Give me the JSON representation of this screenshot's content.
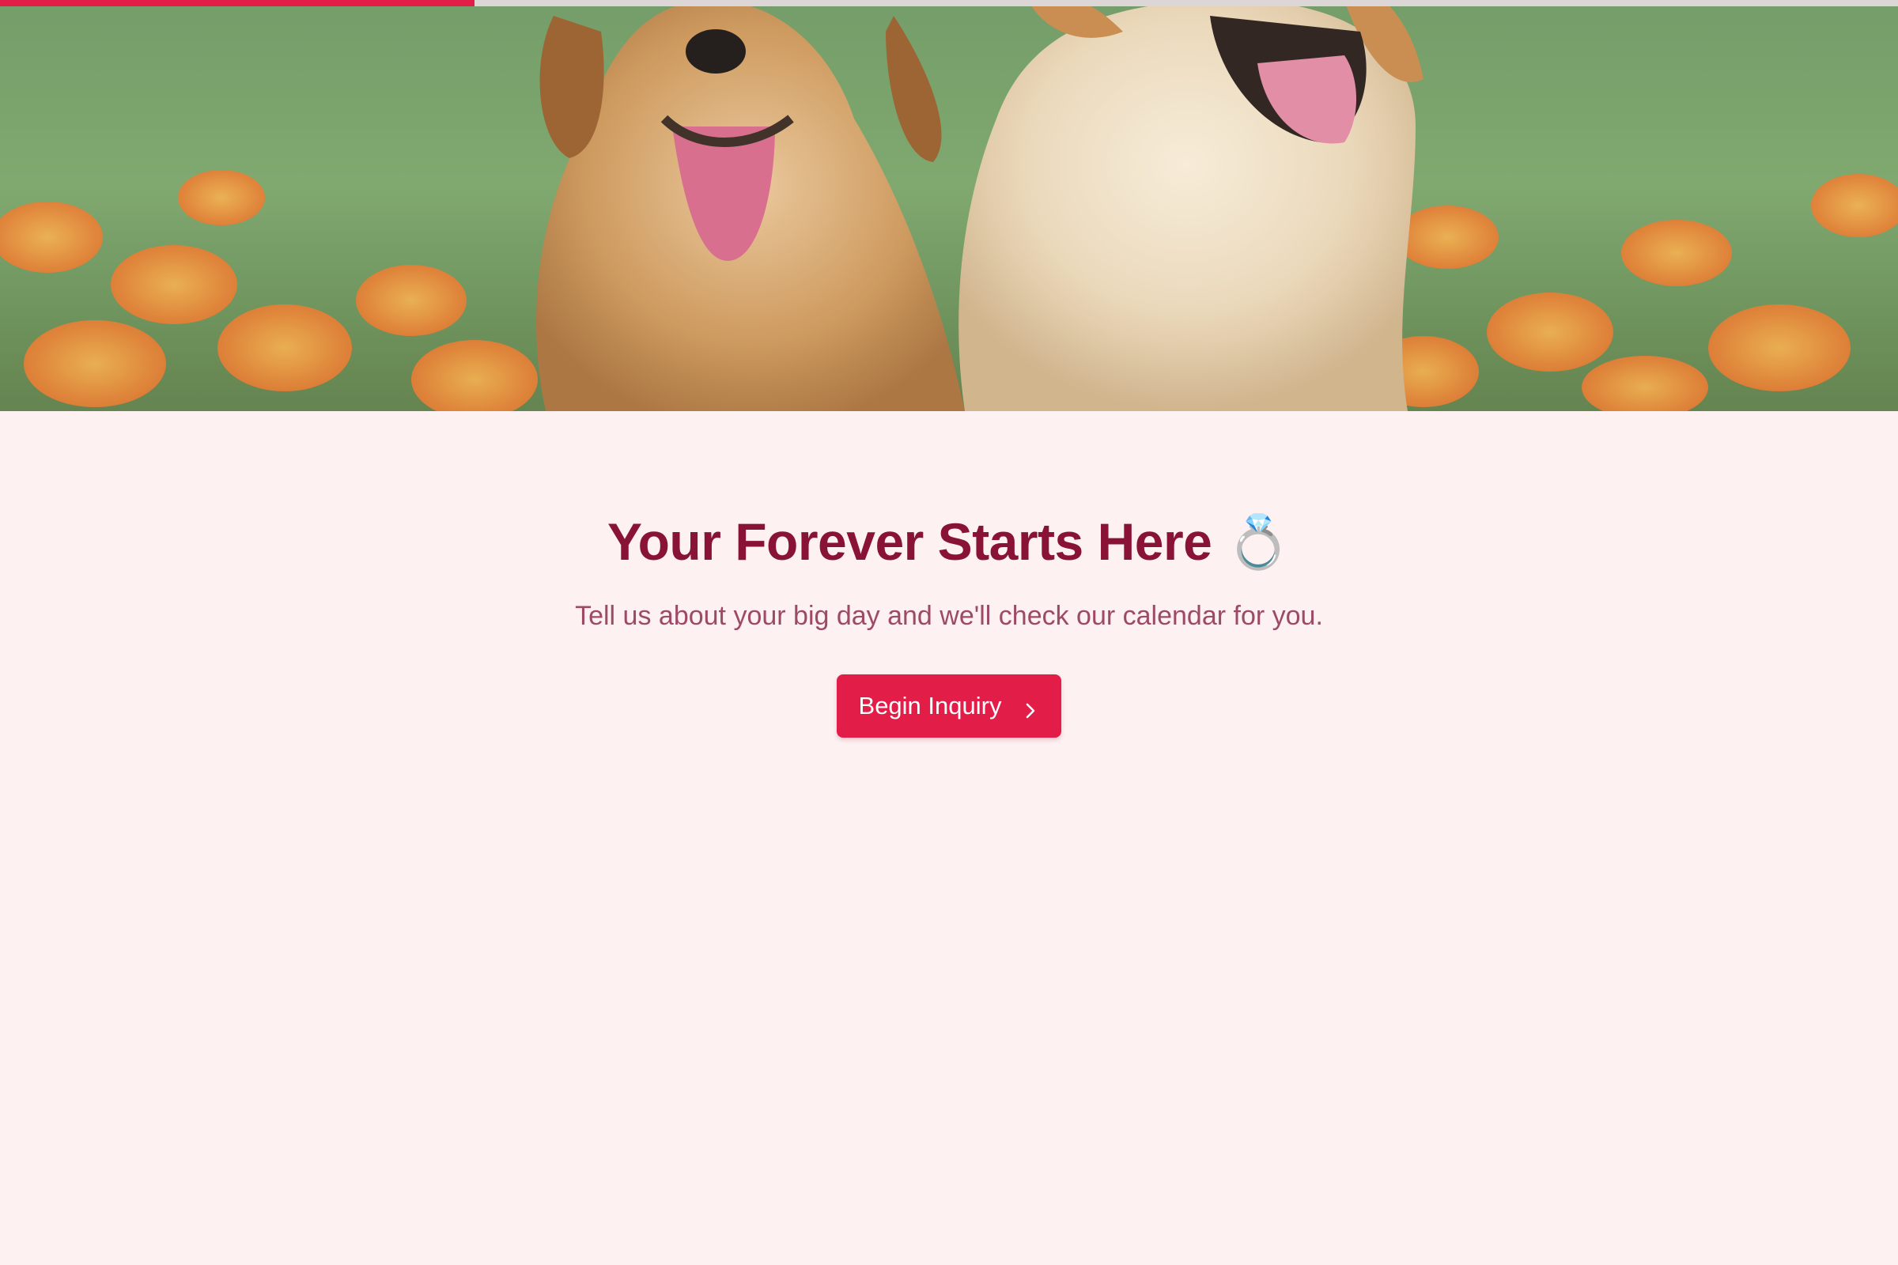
{
  "progress": {
    "fraction": 0.25,
    "color": "#e11d48"
  },
  "hero": {
    "image": "two golden retriever puppies in a field of orange flowers"
  },
  "main": {
    "title": "Your Forever Starts Here",
    "title_emoji": "💍",
    "subtitle": "Tell us about your big day and we'll check our calendar for you.",
    "cta_label": "Begin Inquiry",
    "cta_icon": "chevron-right-icon"
  },
  "colors": {
    "background": "#fdf1f1",
    "title": "#881337",
    "subtitle": "#9d4a66",
    "accent": "#e11d48"
  }
}
